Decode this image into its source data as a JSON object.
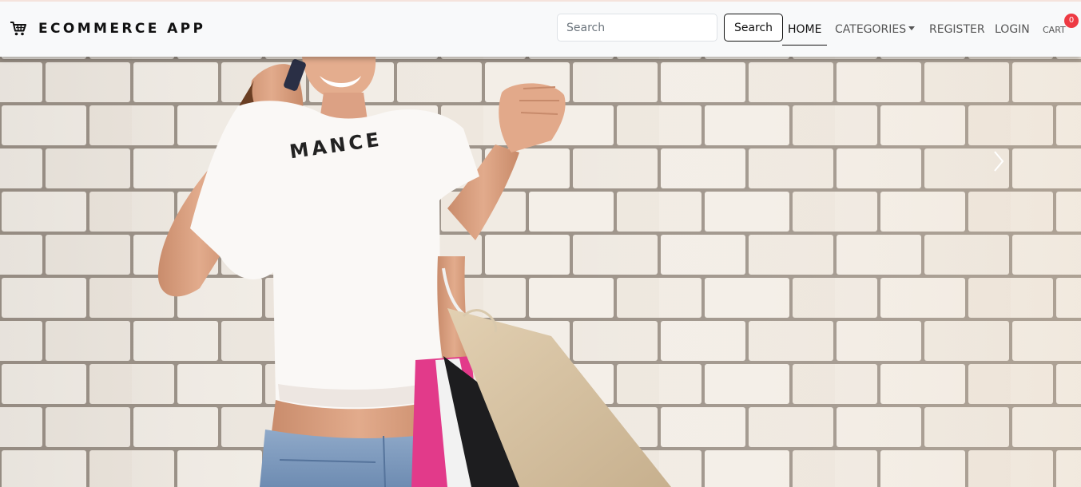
{
  "brand": {
    "name": "ECOMMERCE APP",
    "icon": "shopping-cart-icon"
  },
  "search": {
    "placeholder": "Search",
    "value": "",
    "button_label": "Search"
  },
  "nav": {
    "home": "HOME",
    "categories": "CATEGORIES",
    "register": "REGISTER",
    "login": "LOGIN",
    "cart": "CART",
    "cart_count": "0"
  },
  "hero": {
    "shirt_text": "MANCE",
    "next_icon": "chevron-right-icon"
  },
  "colors": {
    "navbar_bg": "#f8f9fa",
    "badge": "#ee3a43",
    "active_link": "#111111",
    "link": "#555555"
  }
}
